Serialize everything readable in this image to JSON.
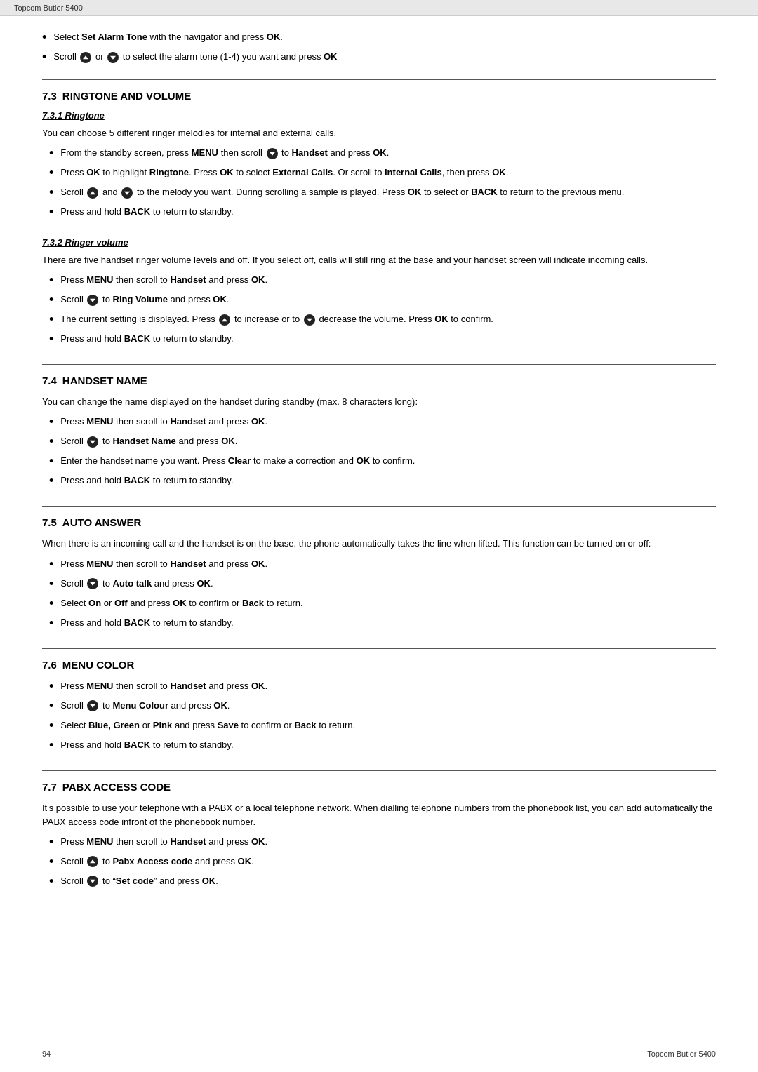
{
  "header": {
    "text": "Topcom Butler 5400"
  },
  "footer": {
    "left": "94",
    "right": "Topcom Butler 5400"
  },
  "top_bullets": [
    {
      "parts": [
        {
          "text": "Select "
        },
        {
          "text": "Set Alarm Tone",
          "bold": true
        },
        {
          "text": " with the navigator and press "
        },
        {
          "text": "OK",
          "bold": true
        },
        {
          "text": "."
        }
      ]
    },
    {
      "parts": [
        {
          "text": "Scroll "
        },
        {
          "icon": "up"
        },
        {
          "text": " or "
        },
        {
          "icon": "down"
        },
        {
          "text": " to select the alarm tone (1-4) you want and press "
        },
        {
          "text": "OK",
          "bold": true
        }
      ]
    }
  ],
  "sections": [
    {
      "id": "7.3",
      "title": "RINGTONE AND VOLUME",
      "subsections": [
        {
          "id": "7.3.1",
          "title": "Ringtone",
          "paragraphs": [
            "You can choose 5 different ringer melodies for internal and external calls."
          ],
          "bullets": [
            [
              {
                "text": "From the standby screen, press "
              },
              {
                "text": "MENU",
                "bold": true
              },
              {
                "text": " then scroll "
              },
              {
                "icon": "down"
              },
              {
                "text": " to "
              },
              {
                "text": "Handset",
                "bold": true
              },
              {
                "text": " and press "
              },
              {
                "text": "OK",
                "bold": true
              },
              {
                "text": "."
              }
            ],
            [
              {
                "text": "Press "
              },
              {
                "text": "OK",
                "bold": true
              },
              {
                "text": " to highlight "
              },
              {
                "text": "Ringtone",
                "bold": true
              },
              {
                "text": ". Press "
              },
              {
                "text": "OK",
                "bold": true
              },
              {
                "text": " to select "
              },
              {
                "text": "External Calls",
                "bold": true
              },
              {
                "text": ". Or scroll to "
              },
              {
                "text": "Internal Calls",
                "bold": true
              },
              {
                "text": ", then press "
              },
              {
                "text": "OK",
                "bold": true
              },
              {
                "text": "."
              }
            ],
            [
              {
                "text": "Scroll "
              },
              {
                "icon": "up"
              },
              {
                "text": " and "
              },
              {
                "icon": "down"
              },
              {
                "text": " to the melody you want. During scrolling a sample is played. Press "
              },
              {
                "text": "OK",
                "bold": true
              },
              {
                "text": " to select or "
              },
              {
                "text": "BACK",
                "bold": true
              },
              {
                "text": " to return to the previous menu."
              }
            ],
            [
              {
                "text": "Press and hold "
              },
              {
                "text": "BACK",
                "bold": true
              },
              {
                "text": " to return to standby."
              }
            ]
          ]
        },
        {
          "id": "7.3.2",
          "title": "Ringer volume",
          "paragraphs": [
            "There are five handset ringer volume levels and off. If you select off, calls will still ring at the base and your handset screen will indicate incoming calls."
          ],
          "bullets": [
            [
              {
                "text": "Press "
              },
              {
                "text": "MENU",
                "bold": true
              },
              {
                "text": " then scroll to "
              },
              {
                "text": "Handset",
                "bold": true
              },
              {
                "text": " and press "
              },
              {
                "text": "OK",
                "bold": true
              },
              {
                "text": "."
              }
            ],
            [
              {
                "text": "Scroll "
              },
              {
                "icon": "down"
              },
              {
                "text": " to "
              },
              {
                "text": "Ring Volume",
                "bold": true
              },
              {
                "text": " and press "
              },
              {
                "text": "OK",
                "bold": true
              },
              {
                "text": "."
              }
            ],
            [
              {
                "text": "The current setting is displayed. Press "
              },
              {
                "icon": "up"
              },
              {
                "text": " to increase or to "
              },
              {
                "icon": "down"
              },
              {
                "text": " decrease the volume. Press "
              },
              {
                "text": "OK",
                "bold": true
              },
              {
                "text": " to confirm."
              }
            ],
            [
              {
                "text": "Press and hold "
              },
              {
                "text": "BACK",
                "bold": true
              },
              {
                "text": " to return to standby."
              }
            ]
          ]
        }
      ]
    },
    {
      "id": "7.4",
      "title": "HANDSET NAME",
      "paragraphs": [
        "You can change the name displayed on the handset during standby (max. 8 characters long):"
      ],
      "bullets": [
        [
          {
            "text": "Press "
          },
          {
            "text": "MENU",
            "bold": true
          },
          {
            "text": " then scroll to "
          },
          {
            "text": "Handset",
            "bold": true
          },
          {
            "text": " and press "
          },
          {
            "text": "OK",
            "bold": true
          },
          {
            "text": "."
          }
        ],
        [
          {
            "text": "Scroll "
          },
          {
            "icon": "down"
          },
          {
            "text": " to "
          },
          {
            "text": "Handset Name",
            "bold": true
          },
          {
            "text": " and press "
          },
          {
            "text": "OK",
            "bold": true
          },
          {
            "text": "."
          }
        ],
        [
          {
            "text": "Enter the handset name you want. Press "
          },
          {
            "text": "Clear",
            "bold": true
          },
          {
            "text": " to make a correction and "
          },
          {
            "text": "OK",
            "bold": true
          },
          {
            "text": " to confirm."
          }
        ],
        [
          {
            "text": "Press and hold "
          },
          {
            "text": "BACK",
            "bold": true
          },
          {
            "text": " to return to standby."
          }
        ]
      ]
    },
    {
      "id": "7.5",
      "title": "AUTO ANSWER",
      "paragraphs": [
        "When there is an incoming call and the handset is on the base, the phone automatically takes the line when lifted. This function can be turned on or off:"
      ],
      "bullets": [
        [
          {
            "text": "Press "
          },
          {
            "text": "MENU",
            "bold": true
          },
          {
            "text": " then scroll to "
          },
          {
            "text": "Handset",
            "bold": true
          },
          {
            "text": " and press "
          },
          {
            "text": "OK",
            "bold": true
          },
          {
            "text": "."
          }
        ],
        [
          {
            "text": "Scroll "
          },
          {
            "icon": "down"
          },
          {
            "text": " to "
          },
          {
            "text": "Auto talk",
            "bold": true
          },
          {
            "text": " and press "
          },
          {
            "text": "OK",
            "bold": true
          },
          {
            "text": "."
          }
        ],
        [
          {
            "text": "Select "
          },
          {
            "text": "On",
            "bold": true
          },
          {
            "text": " or "
          },
          {
            "text": "Off",
            "bold": true
          },
          {
            "text": " and press "
          },
          {
            "text": "OK",
            "bold": true
          },
          {
            "text": " to confirm or "
          },
          {
            "text": "Back",
            "bold": true
          },
          {
            "text": " to return."
          }
        ],
        [
          {
            "text": "Press and hold "
          },
          {
            "text": "BACK",
            "bold": true
          },
          {
            "text": " to return to standby."
          }
        ]
      ]
    },
    {
      "id": "7.6",
      "title": "MENU COLOR",
      "bullets": [
        [
          {
            "text": "Press "
          },
          {
            "text": "MENU",
            "bold": true
          },
          {
            "text": " then scroll to "
          },
          {
            "text": "Handset",
            "bold": true
          },
          {
            "text": " and press "
          },
          {
            "text": "OK",
            "bold": true
          },
          {
            "text": "."
          }
        ],
        [
          {
            "text": "Scroll "
          },
          {
            "icon": "down"
          },
          {
            "text": " to "
          },
          {
            "text": "Menu Colour",
            "bold": true
          },
          {
            "text": " and press "
          },
          {
            "text": "OK",
            "bold": true
          },
          {
            "text": "."
          }
        ],
        [
          {
            "text": "Select "
          },
          {
            "text": "Blue, Green",
            "bold": true
          },
          {
            "text": " or "
          },
          {
            "text": "Pink",
            "bold": true
          },
          {
            "text": " and press "
          },
          {
            "text": "Save",
            "bold": true
          },
          {
            "text": " to confirm or "
          },
          {
            "text": "Back",
            "bold": true
          },
          {
            "text": " to return."
          }
        ],
        [
          {
            "text": "Press and hold "
          },
          {
            "text": "BACK",
            "bold": true
          },
          {
            "text": " to return to standby."
          }
        ]
      ]
    },
    {
      "id": "7.7",
      "title": "PABX ACCESS CODE",
      "paragraphs": [
        "It's possible to use your telephone with a PABX or a local telephone network. When dialling telephone numbers from the phonebook list, you can add automatically the PABX access code infront of the phonebook number."
      ],
      "bullets": [
        [
          {
            "text": "Press "
          },
          {
            "text": "MENU",
            "bold": true
          },
          {
            "text": " then scroll to "
          },
          {
            "text": "Handset",
            "bold": true
          },
          {
            "text": " and press "
          },
          {
            "text": "OK",
            "bold": true
          },
          {
            "text": "."
          }
        ],
        [
          {
            "text": "Scroll "
          },
          {
            "icon": "up"
          },
          {
            "text": " to "
          },
          {
            "text": "Pabx Access code",
            "bold": true
          },
          {
            "text": " and press "
          },
          {
            "text": "OK",
            "bold": true
          },
          {
            "text": "."
          }
        ],
        [
          {
            "text": "Scroll "
          },
          {
            "icon": "down"
          },
          {
            "text": " to “"
          },
          {
            "text": "Set code",
            "bold": true
          },
          {
            "text": "” and press "
          },
          {
            "text": "OK",
            "bold": true
          },
          {
            "text": "."
          }
        ]
      ]
    }
  ]
}
